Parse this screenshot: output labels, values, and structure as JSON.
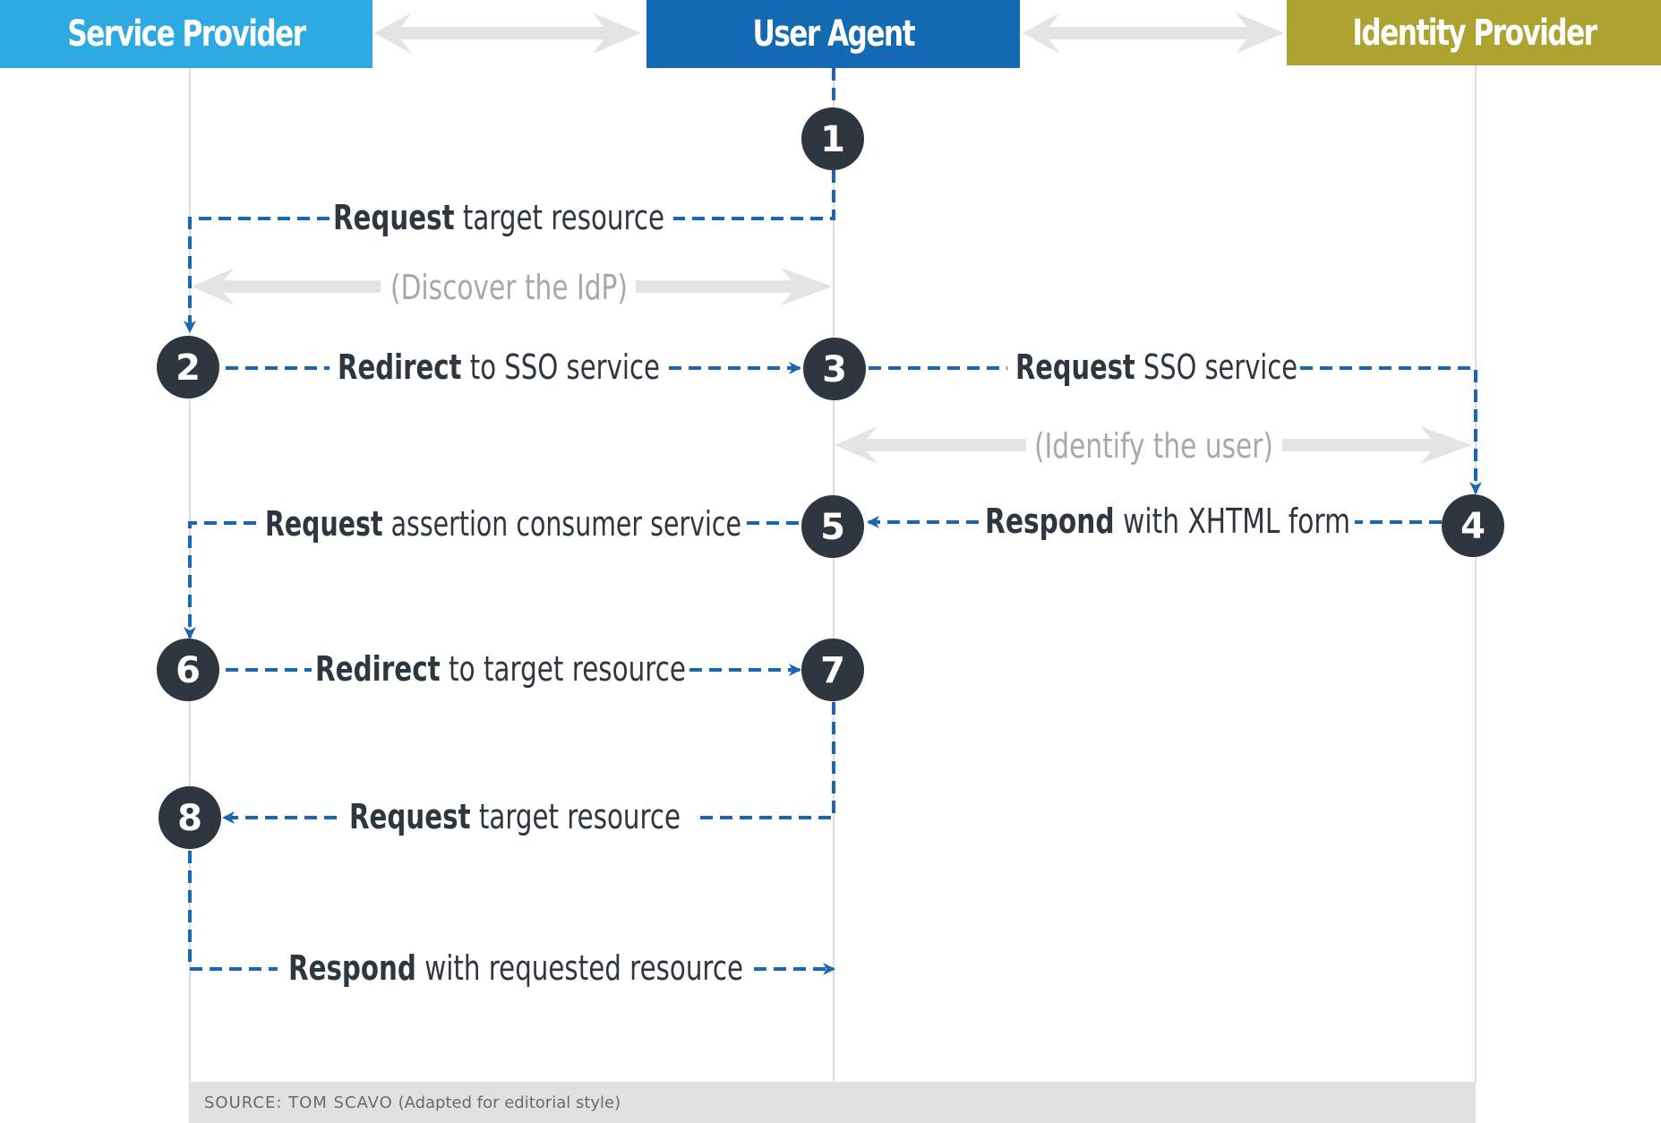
{
  "headers": {
    "service_provider": {
      "label": "Service Provider",
      "color": "#2eaae2"
    },
    "user_agent": {
      "label": "User Agent",
      "color": "#1469b3"
    },
    "identity_provider": {
      "label": "Identity Provider",
      "color": "#aea231"
    }
  },
  "colors": {
    "arrow": "#1a66b0",
    "lifeline": "#dddddd",
    "gray_arrow": "#e4e4e4",
    "circle": "#2e3640"
  },
  "steps": [
    {
      "number": "1"
    },
    {
      "number": "2"
    },
    {
      "number": "3"
    },
    {
      "number": "4"
    },
    {
      "number": "5"
    },
    {
      "number": "6"
    },
    {
      "number": "7"
    },
    {
      "number": "8"
    }
  ],
  "messages": [
    {
      "bold": "Request",
      "rest": " target resource"
    },
    {
      "bold": "Redirect",
      "rest": " to SSO service"
    },
    {
      "bold": "Request",
      "rest": " SSO service"
    },
    {
      "bold": "Respond",
      "rest": " with XHTML form"
    },
    {
      "bold": "Request",
      "rest": " assertion consumer service"
    },
    {
      "bold": "Redirect",
      "rest": " to target resource"
    },
    {
      "bold": "Request",
      "rest": " target resource"
    },
    {
      "bold": "Respond",
      "rest": " with requested resource"
    }
  ],
  "annotations": {
    "discover": "(Discover the IdP)",
    "identify": "(Identify the user)"
  },
  "footer": {
    "source": "SOURCE: TOM SCAVO",
    "note": " (Adapted for editorial style)"
  }
}
